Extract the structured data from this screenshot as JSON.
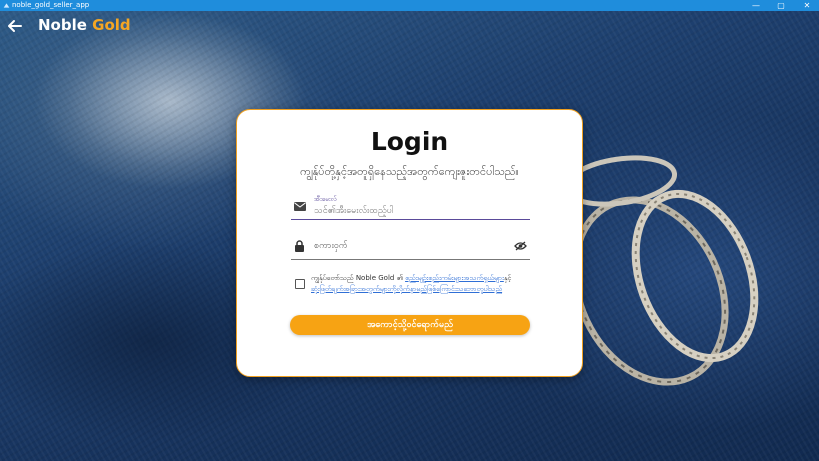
{
  "window": {
    "title": "noble_gold_seller_app",
    "minimize": "—",
    "maximize": "▢",
    "close": "✕"
  },
  "appbar": {
    "brand_primary": "Noble",
    "brand_accent": "Gold",
    "back_icon": "arrow-left-icon"
  },
  "login_card": {
    "title": "Login",
    "subtitle": "ကျွန်ုပ်တို့နှင့်အတူရှိနေသည့်အတွက်ကျေးဇူးတင်ပါသည်။",
    "email_field": {
      "label": "အီးမေးလ်",
      "placeholder": "သင်၏အီးမေးလ်းထည့်ပါ",
      "icon": "mail-icon"
    },
    "password_field": {
      "placeholder": "စကားဝှက်",
      "icon": "lock-icon",
      "toggle_icon": "eye-off-icon"
    },
    "terms": {
      "prefix": "ကျွန်ုပ်တော်သည် Noble Gold ၏",
      "link1": "စည်းမျဉ်းစည်းကမ်းများအသက်ရှယ်များ",
      "middle": "နှင့်",
      "link2": "ဆုံးဖြတ်ချက်အခြားအတွက်များကိုလိုက်နာမည်ဖြစ်ကြောင်းသဘောတူပါသည်",
      "checked": false
    },
    "login_button": "အကောင့်သို့ဝင်ရောက်မည်"
  },
  "colors": {
    "accent": "#f7a313",
    "brand_gold": "#f5a623",
    "titlebar": "#1f8ddc",
    "link": "#2f6fd6",
    "field_focus": "#5a4a9a"
  }
}
